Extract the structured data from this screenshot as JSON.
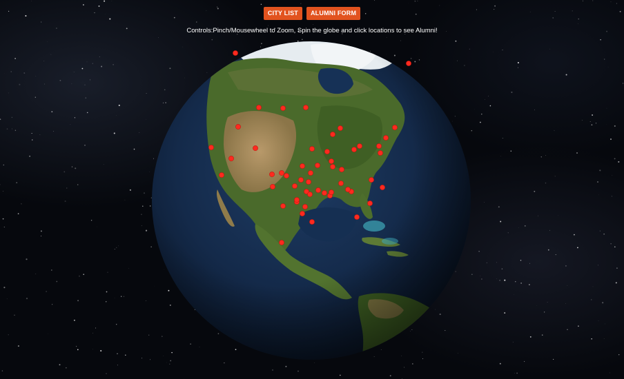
{
  "toolbar": {
    "city_list_label": "CITY LIST",
    "alumni_form_label": "ALUMNI FORM"
  },
  "instructions": {
    "text": "Controls:Pinch/Mousewheel to Zoom, Spin the globe and click locations to see Alumni!"
  },
  "colors": {
    "button_bg": "#e2531f",
    "marker": "#ff2a1f",
    "ocean": "#13294a",
    "land": "#4b6a2c",
    "desert": "#a48a55",
    "ice": "#e8eef2"
  },
  "globe": {
    "view": "North America facing the viewer",
    "marker_icon": "location-marker-icon"
  }
}
